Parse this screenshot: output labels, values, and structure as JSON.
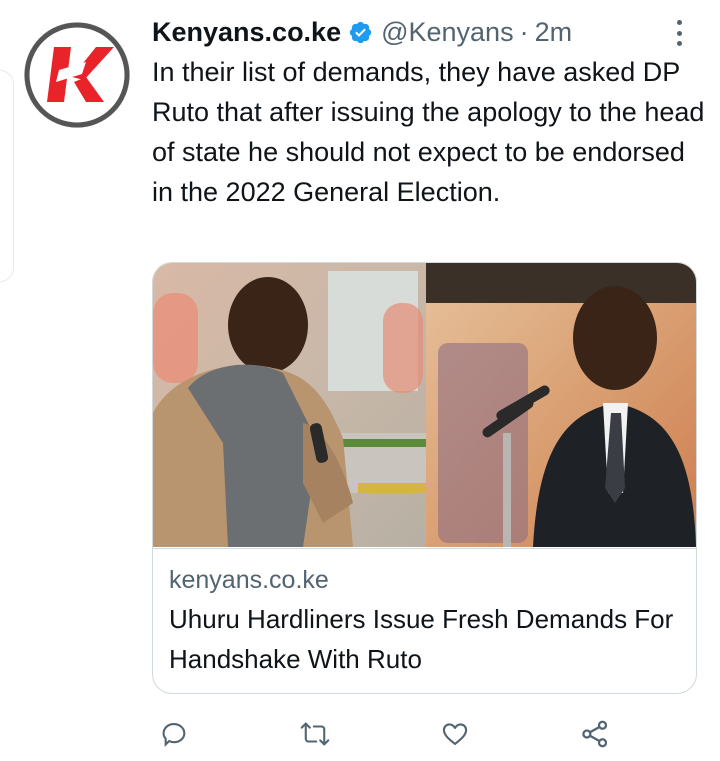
{
  "tweet": {
    "author_name": "Kenyans.co.ke",
    "handle": "@Kenyans",
    "separator": "·",
    "time": "2m",
    "text": "In their list of demands, they have asked DP Ruto that after issuing the apology to the head of state he should not expect to be endorsed in the 2022 General Election.",
    "avatar_icon": "kenyans-logo-icon",
    "verified_icon": "verified-badge-icon",
    "more_icon": "more-options-icon"
  },
  "card": {
    "domain": "kenyans.co.ke",
    "title": "Uhuru Hardliners Issue Fresh Demands For Handshake With Ruto"
  },
  "actions": [
    {
      "name": "reply-icon"
    },
    {
      "name": "retweet-icon"
    },
    {
      "name": "like-icon"
    },
    {
      "name": "share-icon"
    }
  ],
  "colors": {
    "accent": "#1d9bf0",
    "brand_red": "#e8232a",
    "secondary_text": "#536471",
    "border": "#cfd9de"
  }
}
